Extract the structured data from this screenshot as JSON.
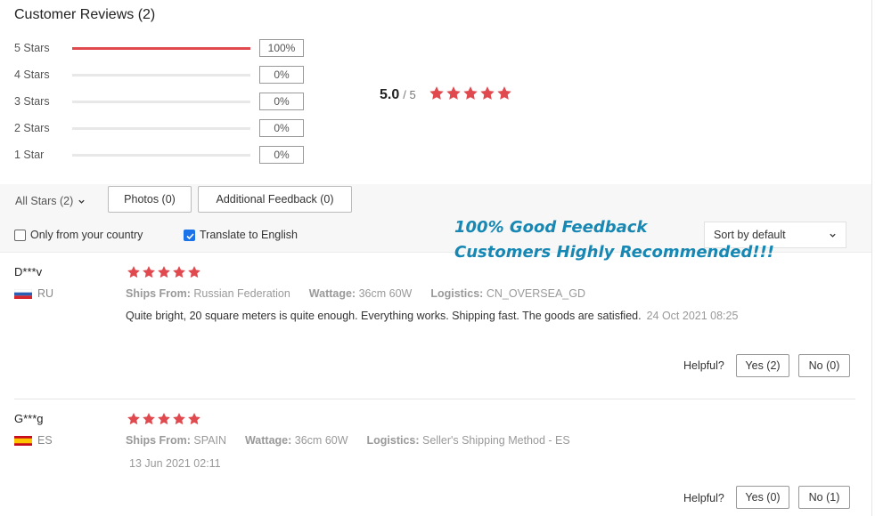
{
  "title": "Customer Reviews (2)",
  "distribution": [
    {
      "label": "5 Stars",
      "pct": "100%",
      "fill": 1.0
    },
    {
      "label": "4 Stars",
      "pct": "0%",
      "fill": 0
    },
    {
      "label": "3 Stars",
      "pct": "0%",
      "fill": 0
    },
    {
      "label": "2 Stars",
      "pct": "0%",
      "fill": 0
    },
    {
      "label": "1 Star",
      "pct": "0%",
      "fill": 0
    }
  ],
  "summary": {
    "score": "5.0",
    "max": "/ 5",
    "stars": 5
  },
  "filters": {
    "all_stars": "All Stars (2)",
    "photos": "Photos (0)",
    "additional": "Additional Feedback (0)",
    "only_country": "Only from your country",
    "only_country_checked": false,
    "translate": "Translate to English",
    "translate_checked": true,
    "sort": "Sort by default"
  },
  "promo": {
    "line1": "100% Good Feedback",
    "line2": "Customers Highly Recommended!!!"
  },
  "reviews": [
    {
      "name": "D***v",
      "country": "RU",
      "flag": "ru-flag-icon",
      "stars": 5,
      "ships_from_label": "Ships From:",
      "ships_from": "Russian Federation",
      "wattage_label": "Wattage:",
      "wattage": "36cm 60W",
      "logistics_label": "Logistics:",
      "logistics": "CN_OVERSEA_GD",
      "text": "Quite bright, 20 square meters is quite enough. Everything works. Shipping fast. The goods are satisfied.",
      "date": "24 Oct 2021 08:25",
      "helpful": "Helpful?",
      "yes": "Yes (2)",
      "no": "No (0)"
    },
    {
      "name": "G***g",
      "country": "ES",
      "flag": "es-flag-icon",
      "stars": 5,
      "ships_from_label": "Ships From:",
      "ships_from": "SPAIN",
      "wattage_label": "Wattage:",
      "wattage": "36cm 60W",
      "logistics_label": "Logistics:",
      "logistics": "Seller's Shipping Method - ES",
      "text": "",
      "date": "13 Jun 2021 02:11",
      "helpful": "Helpful?",
      "yes": "Yes (0)",
      "no": "No (1)"
    }
  ],
  "colors": {
    "accent": "#e0494e",
    "promo": "#1787b3",
    "check": "#1a73e8"
  }
}
